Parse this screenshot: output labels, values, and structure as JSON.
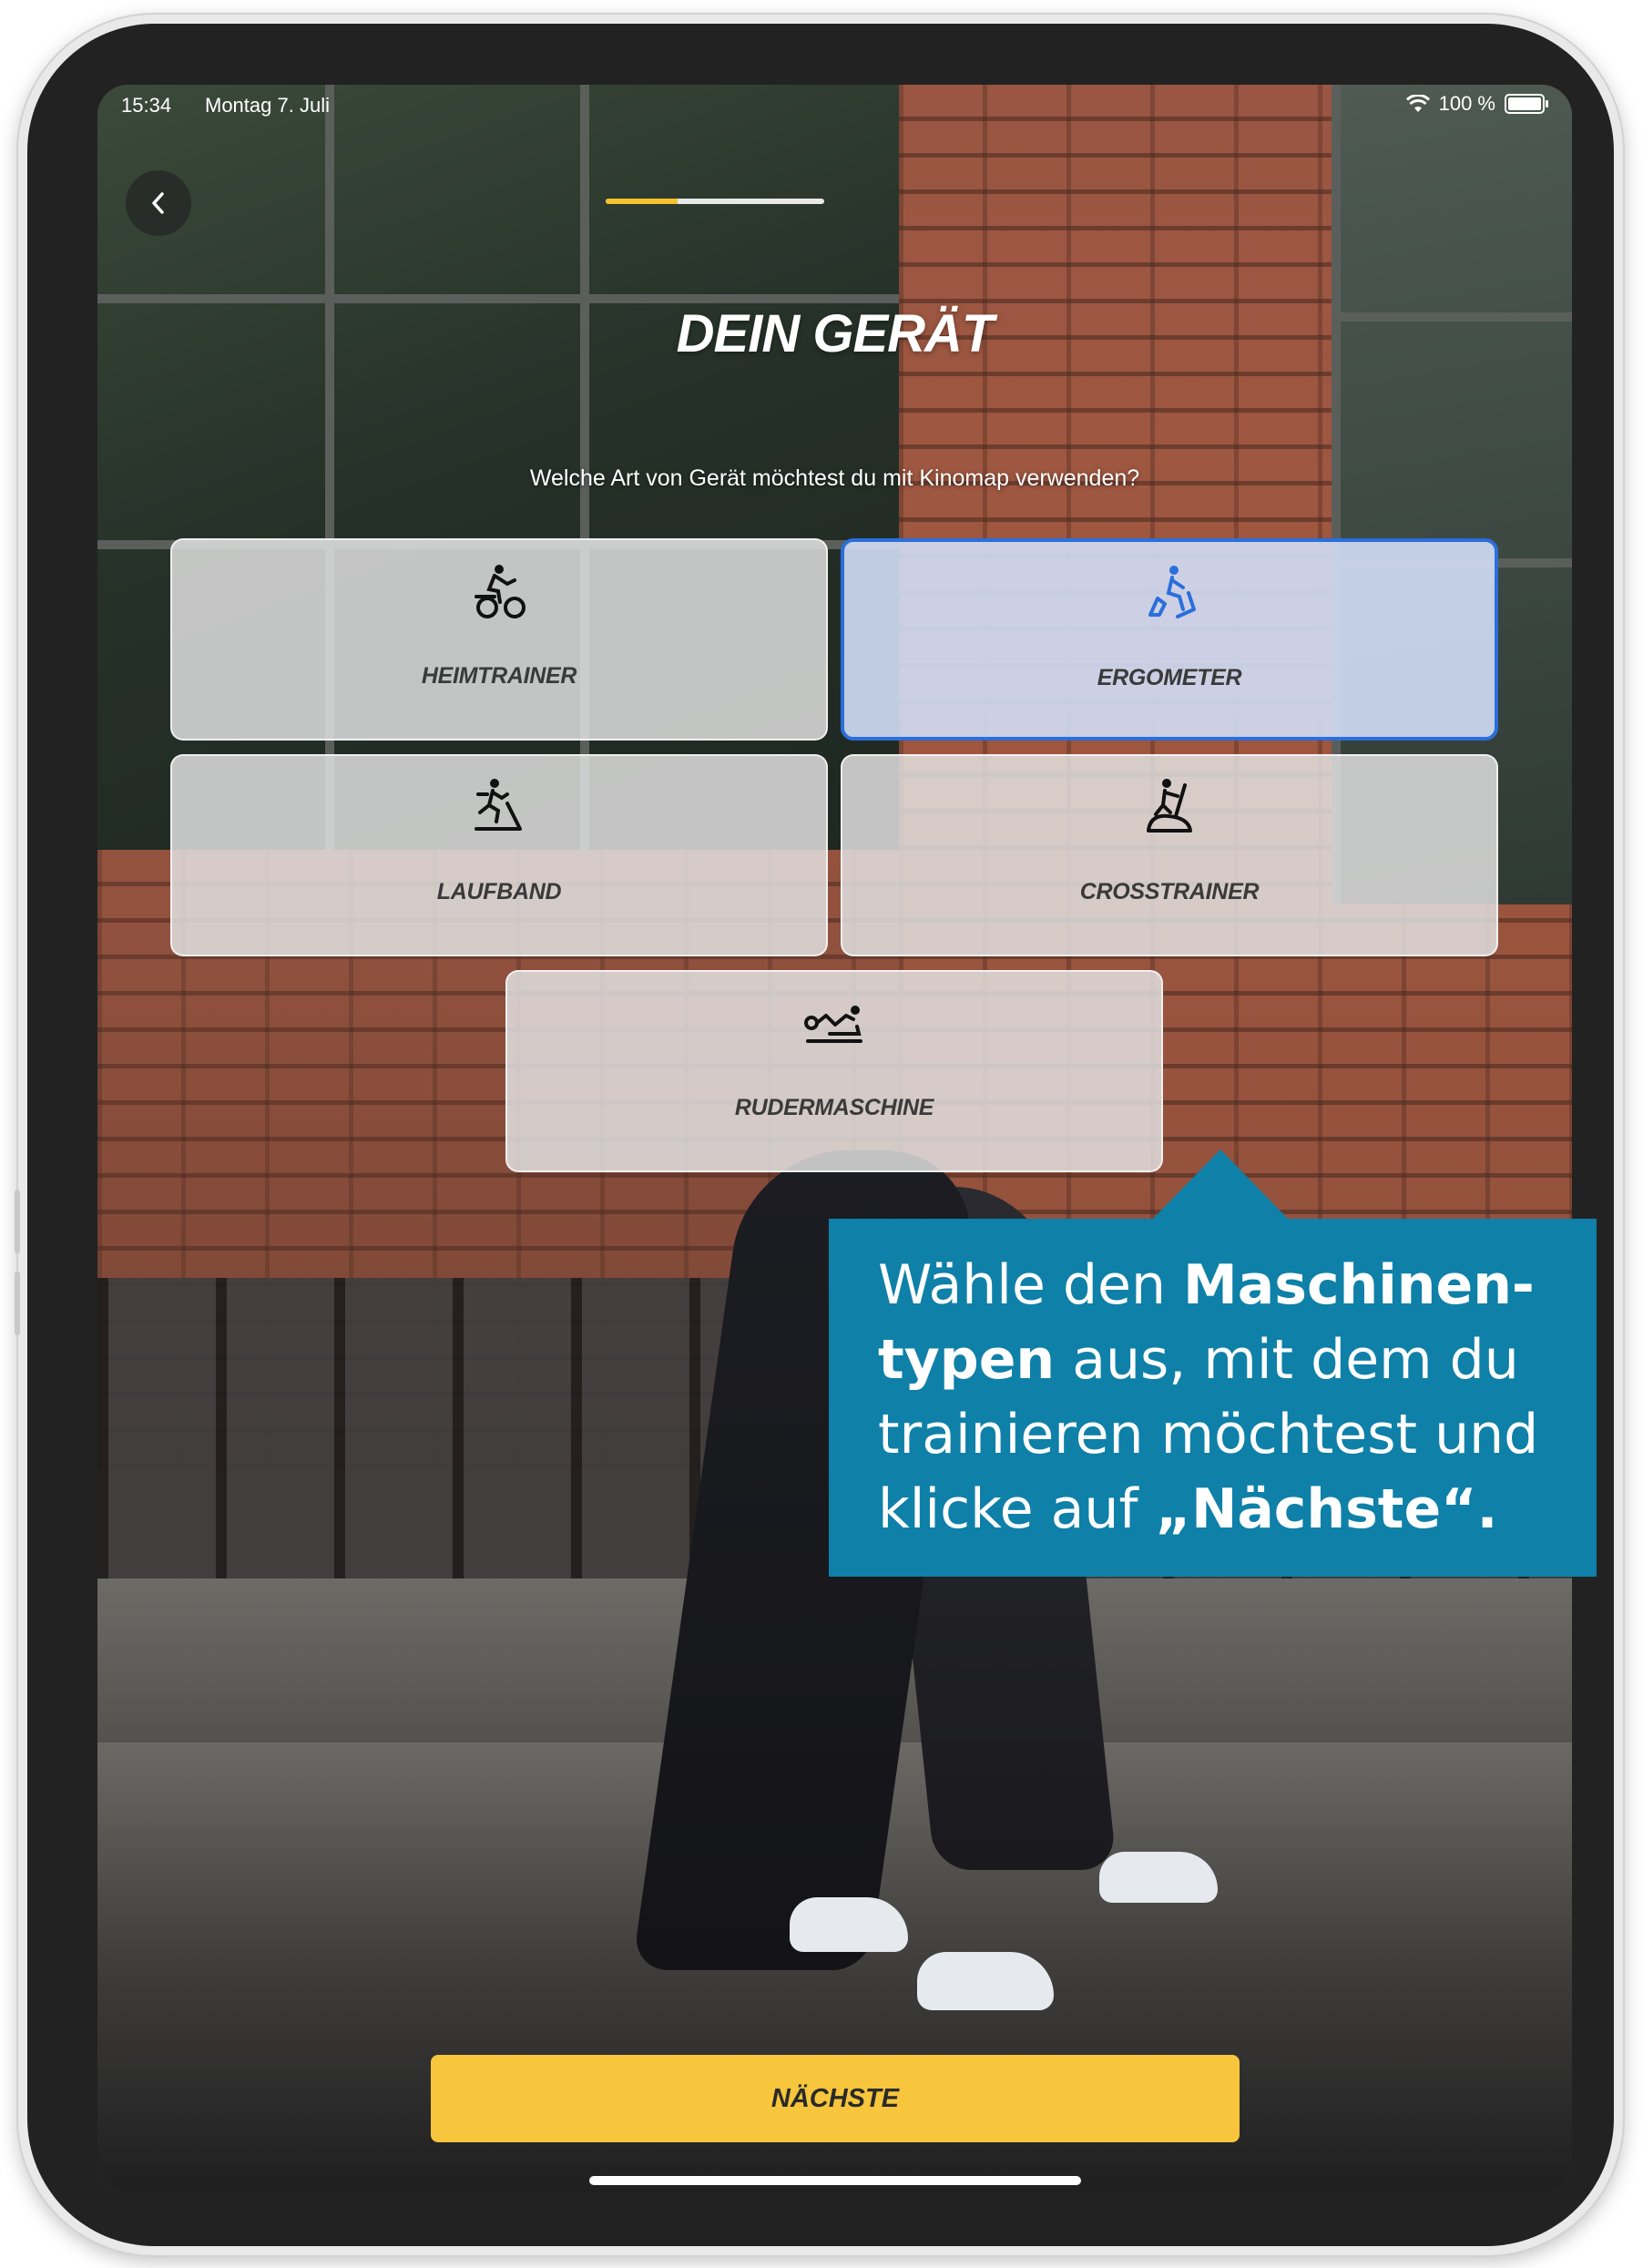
{
  "status_bar": {
    "time": "15:34",
    "date": "Montag 7. Juli",
    "battery_text": "100 %",
    "battery_level": 1.0
  },
  "onboarding": {
    "progress_fraction": 0.33,
    "title": "DEIN GERÄT",
    "subtitle": "Welche Art von Gerät möchtest du mit Kinomap verwenden?"
  },
  "devices": [
    {
      "label": "HEIMTRAINER",
      "icon": "exercise-bike-icon",
      "selected": false
    },
    {
      "label": "ERGOMETER",
      "icon": "ergometer-icon",
      "selected": true
    },
    {
      "label": "LAUFBAND",
      "icon": "treadmill-icon",
      "selected": false
    },
    {
      "label": "CROSSTRAINER",
      "icon": "crosstrainer-icon",
      "selected": false
    },
    {
      "label": "RUDERMASCHINE",
      "icon": "rowing-machine-icon",
      "selected": false
    }
  ],
  "next_button": {
    "label": "NÄCHSTE",
    "color": "#f7c63c"
  },
  "callout": {
    "part1": "Wähle den ",
    "bold1": "Maschinen-typen",
    "part2": " aus, mit dem du trainieren möchtest und klicke auf ",
    "bold2": "„Nächste“.",
    "color": "#0f80a8"
  },
  "accent_selected": "#2a6fdb"
}
